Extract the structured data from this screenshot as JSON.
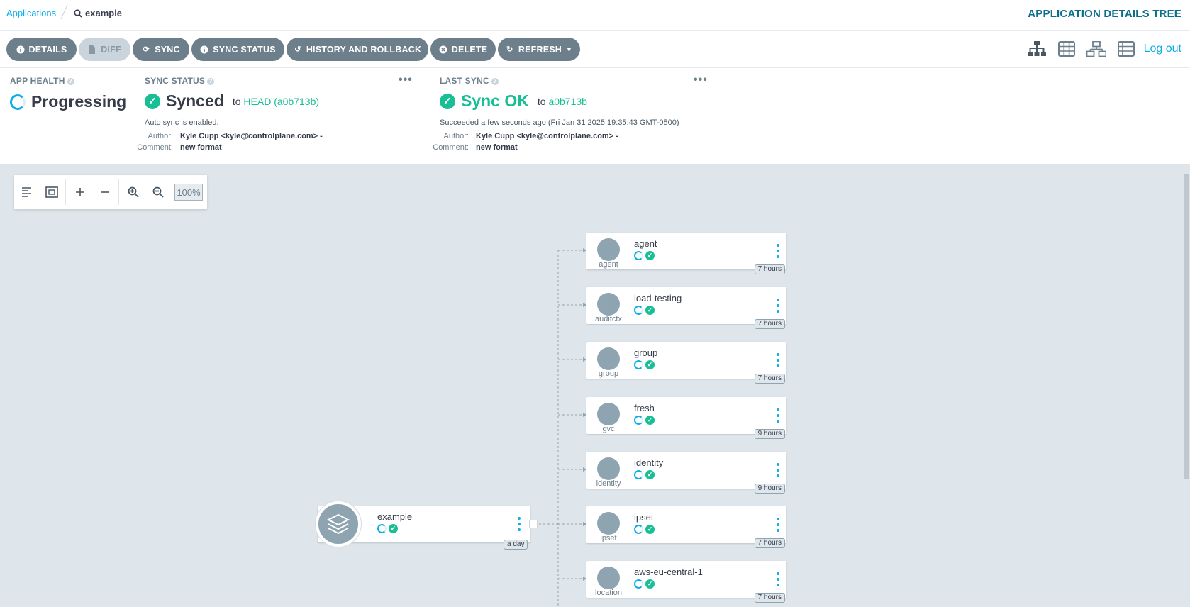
{
  "breadcrumb": {
    "applications": "Applications",
    "current": "example"
  },
  "page_title": "APPLICATION DETAILS TREE",
  "toolbar": {
    "details": "DETAILS",
    "diff": "DIFF",
    "sync": "SYNC",
    "sync_status": "SYNC STATUS",
    "history": "HISTORY AND ROLLBACK",
    "delete": "DELETE",
    "refresh": "REFRESH",
    "logout": "Log out"
  },
  "app_health": {
    "label": "APP HEALTH",
    "value": "Progressing"
  },
  "sync_status": {
    "label": "SYNC STATUS",
    "value": "Synced",
    "to": "to",
    "target": "HEAD (a0b713b)",
    "auto": "Auto sync is enabled.",
    "author_label": "Author:",
    "author": "Kyle Cupp <kyle@controlplane.com> -",
    "comment_label": "Comment:",
    "comment": "new format"
  },
  "last_sync": {
    "label": "LAST SYNC",
    "value": "Sync OK",
    "to": "to",
    "target": "a0b713b",
    "succeeded": "Succeeded a few seconds ago (Fri Jan 31 2025 19:35:43 GMT-0500)",
    "author_label": "Author:",
    "author": "Kyle Cupp <kyle@controlplane.com> -",
    "comment_label": "Comment:",
    "comment": "new format"
  },
  "zoom": {
    "level": "100%"
  },
  "app_node": {
    "name": "example",
    "age": "a day"
  },
  "resources": [
    {
      "name": "agent",
      "kind": "agent",
      "age": "7 hours"
    },
    {
      "name": "load-testing",
      "kind": "auditctx",
      "age": "7 hours"
    },
    {
      "name": "group",
      "kind": "group",
      "age": "7 hours"
    },
    {
      "name": "fresh",
      "kind": "gvc",
      "age": "9 hours"
    },
    {
      "name": "identity",
      "kind": "identity",
      "age": "9 hours"
    },
    {
      "name": "ipset",
      "kind": "ipset",
      "age": "7 hours"
    },
    {
      "name": "aws-eu-central-1",
      "kind": "location",
      "age": "7 hours"
    }
  ],
  "colors": {
    "accent": "#0dadea",
    "ok": "#18be94",
    "button": "#6d7f8b",
    "canvas": "#dee6eb"
  }
}
